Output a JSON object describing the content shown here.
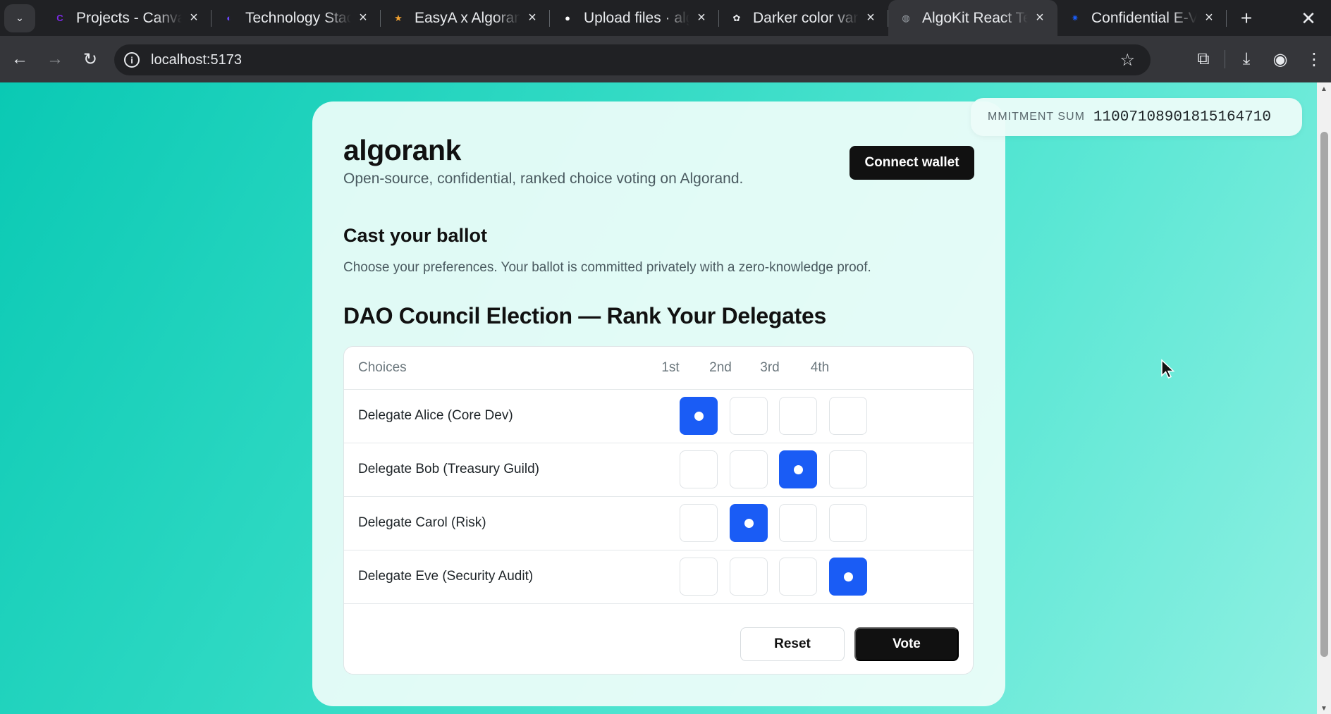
{
  "browser": {
    "tabs": [
      {
        "title": "Projects - Canva",
        "favicon_color": "#7d2ae8",
        "favicon_glyph": "C"
      },
      {
        "title": "Technology Stack",
        "favicon_color": "#6c47ff",
        "favicon_glyph": "◐"
      },
      {
        "title": "EasyA x Algorand",
        "favicon_color": "#f0a030",
        "favicon_glyph": "★"
      },
      {
        "title": "Upload files · algorank",
        "favicon_color": "#ffffff",
        "favicon_glyph": "●"
      },
      {
        "title": "Darker color variant",
        "favicon_color": "#e8eaed",
        "favicon_glyph": "✿"
      },
      {
        "title": "AlgoKit React Template",
        "favicon_color": "#9aa0a6",
        "favicon_glyph": "◍",
        "active": true
      },
      {
        "title": "Confidential E-Voting",
        "favicon_color": "#1a5cf5",
        "favicon_glyph": "✷"
      }
    ],
    "url": "localhost:5173"
  },
  "app": {
    "brand": "algorank",
    "tagline": "Open-source, confidential, ranked choice voting on Algorand.",
    "connect_label": "Connect wallet",
    "ballot_heading": "Cast your ballot",
    "ballot_description": "Choose your preferences. Your ballot is committed privately with a zero-knowledge proof.",
    "election_title": "DAO Council Election — Rank Your Delegates",
    "choices_header": "Choices",
    "rank_labels": [
      "1st",
      "2nd",
      "3rd",
      "4th"
    ],
    "candidates": [
      {
        "name": "Delegate Alice (Core Dev)",
        "rank": 1
      },
      {
        "name": "Delegate Bob (Treasury Guild)",
        "rank": 3
      },
      {
        "name": "Delegate Carol (Risk)",
        "rank": 2
      },
      {
        "name": "Delegate Eve (Security Audit)",
        "rank": 4
      }
    ],
    "reset_label": "Reset",
    "vote_label": "Vote",
    "commitment_label": "MMITMENT SUM",
    "commitment_value": "11007108901815164710",
    "accent_color": "#1a5cf5"
  }
}
